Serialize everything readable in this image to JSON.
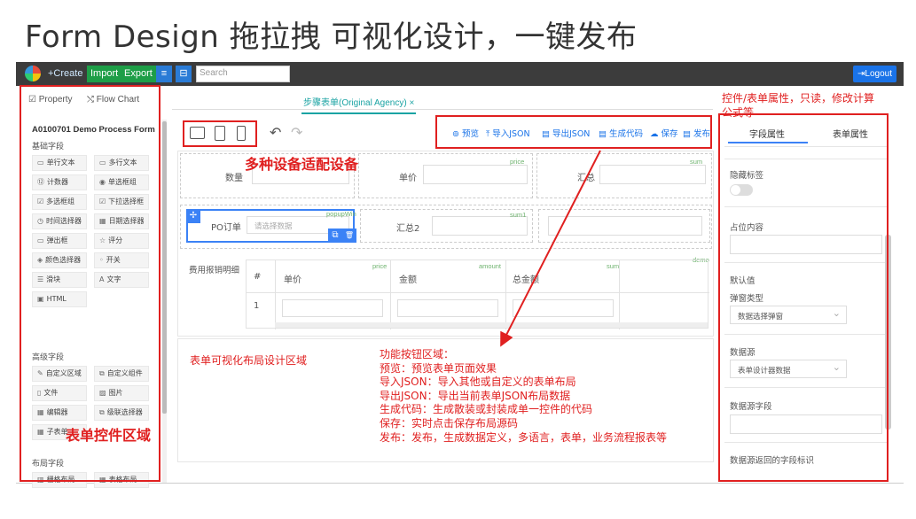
{
  "slide_title": "Form Design 拖拉拽 可视化设计，一键发布",
  "topbar": {
    "create": "+Create",
    "import": "Import",
    "export": "Export",
    "menu_icon": "≡",
    "box_icon": "⊟",
    "search_placeholder": "Search",
    "logout": "⇥Logout"
  },
  "left": {
    "tabs": [
      "Property",
      "Flow Chart"
    ],
    "form_name": "A0100701 Demo Process Form",
    "basic_section": "基础字段",
    "basic_controls": [
      {
        "icon": "▭",
        "label": "单行文本"
      },
      {
        "icon": "▭",
        "label": "多行文本"
      },
      {
        "icon": "⑫",
        "label": "计数器"
      },
      {
        "icon": "◉",
        "label": "单选框组"
      },
      {
        "icon": "☑",
        "label": "多选框组"
      },
      {
        "icon": "☑",
        "label": "下拉选择框"
      },
      {
        "icon": "◷",
        "label": "时间选择器"
      },
      {
        "icon": "▦",
        "label": "日期选择器"
      },
      {
        "icon": "▭",
        "label": "弹出框"
      },
      {
        "icon": "☆",
        "label": "评分"
      },
      {
        "icon": "◈",
        "label": "颜色选择器"
      },
      {
        "icon": "◦",
        "label": "开关"
      },
      {
        "icon": "☰",
        "label": "滑块"
      },
      {
        "icon": "A",
        "label": "文字"
      },
      {
        "icon": "▣",
        "label": "HTML"
      }
    ],
    "advanced_section": "高级字段",
    "advanced_controls": [
      {
        "icon": "✎",
        "label": "自定义区域"
      },
      {
        "icon": "⧉",
        "label": "自定义组件"
      },
      {
        "icon": "▯",
        "label": "文件"
      },
      {
        "icon": "▨",
        "label": "图片"
      },
      {
        "icon": "▦",
        "label": "编辑器"
      },
      {
        "icon": "⧉",
        "label": "级联选择器"
      },
      {
        "icon": "▦",
        "label": "子表单"
      }
    ],
    "layout_section": "布局字段",
    "layout_controls": [
      {
        "icon": "▥",
        "label": "栅格布局"
      },
      {
        "icon": "▦",
        "label": "表格布局"
      }
    ]
  },
  "center": {
    "tab": "步骤表单(Original Agency)  ×",
    "func_buttons": [
      "⊚ 预览",
      "⤒ 导入JSON",
      "▤ 导出JSON",
      "▤ 生成代码",
      "☁ 保存",
      "▤ 发布"
    ],
    "row1": [
      {
        "label": "数量",
        "tag": ""
      },
      {
        "label": "单价",
        "tag": "price"
      },
      {
        "label": "汇总",
        "tag": "sum"
      }
    ],
    "row2": [
      {
        "label": "PO订单",
        "placeholder": "请选择数据",
        "tag": "popupWin"
      },
      {
        "label": "汇总2",
        "tag": "sum1"
      }
    ],
    "table": {
      "label": "费用报销明细",
      "tag": "demo",
      "headers": [
        "#",
        "单价",
        "金额",
        "总金额"
      ],
      "header_tags": [
        "",
        "price",
        "amount",
        "sum"
      ],
      "row_index": "1"
    },
    "handle_move": "✢",
    "handle_copy": "⧉",
    "handle_delete": "🗑"
  },
  "right": {
    "tabs": [
      "字段属性",
      "表单属性"
    ],
    "fields": [
      "隐藏标签",
      "占位内容",
      "默认值",
      "弹窗类型",
      "数据源",
      "数据源字段",
      "数据源返回的字段标识"
    ],
    "popup_type_value": "数据选择弹窗",
    "datasource_value": "表单设计器数据"
  },
  "annotations": {
    "devices": "多种设备适配设备",
    "controls_area": "表单控件区域",
    "layout_area": "表单可视化布局设计区域",
    "props": [
      "控件/表单属性，只读，修改计算",
      "公式等"
    ],
    "func_lines": [
      "功能按钮区域：",
      "预览：预览表单页面效果",
      "导入JSON：导入其他或自定义的表单布局",
      "导出JSON：导出当前表单JSON布局数据",
      "生成代码：生成散装或封装成单一控件的代码",
      "保存：实时点击保存布局源码",
      "发布：发布，生成数据定义，多语言，表单，业务流程报表等"
    ]
  },
  "colors": {
    "accent_red": "#e02020",
    "primary_blue": "#1a73e8",
    "green": "#1e9e47",
    "teal": "#1aa3a3"
  }
}
